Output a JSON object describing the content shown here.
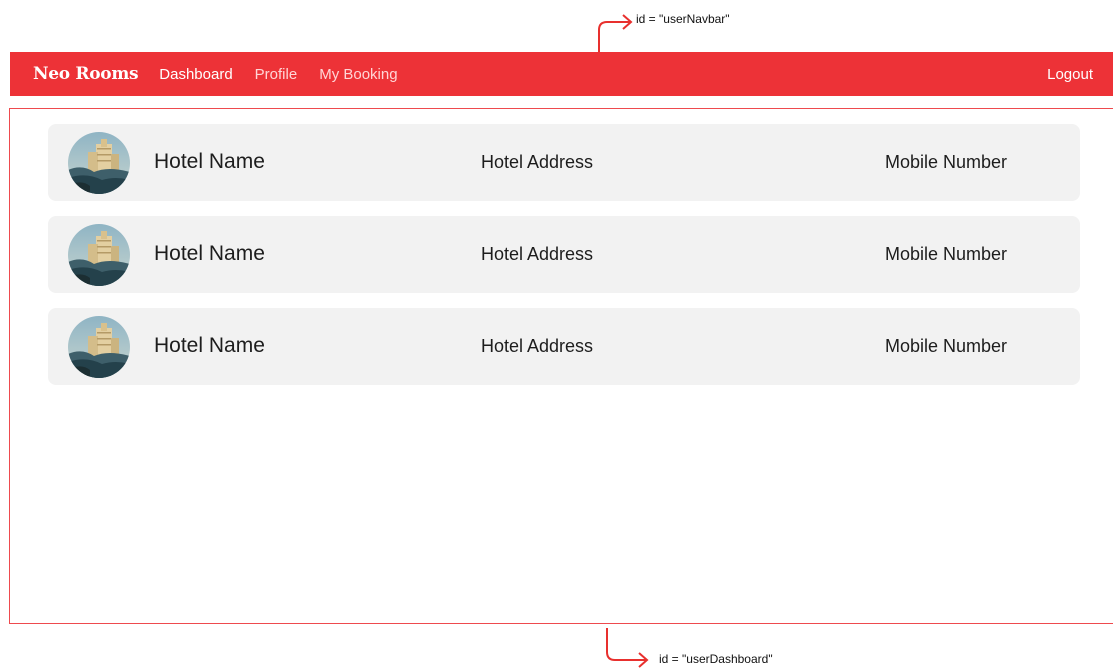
{
  "annotations": {
    "navbar_id": "id = \"userNavbar\"",
    "dashboard_id": "id = \"userDashboard\""
  },
  "colors": {
    "brand_red": "#ed3237",
    "card_background": "#f2f2f2",
    "annotation_arrow": "#e8302e"
  },
  "navbar": {
    "brand": "Neo Rooms",
    "links": [
      {
        "label": "Dashboard",
        "active": true
      },
      {
        "label": "Profile",
        "active": false
      },
      {
        "label": "My Booking",
        "active": false
      }
    ],
    "logout_label": "Logout"
  },
  "dashboard": {
    "hotels": [
      {
        "image_icon": "hotel-photo-icon",
        "name": "Hotel Name",
        "address": "Hotel Address",
        "mobile": "Mobile Number"
      },
      {
        "image_icon": "hotel-photo-icon",
        "name": "Hotel Name",
        "address": "Hotel Address",
        "mobile": "Mobile Number"
      },
      {
        "image_icon": "hotel-photo-icon",
        "name": "Hotel Name",
        "address": "Hotel Address",
        "mobile": "Mobile Number"
      }
    ]
  }
}
